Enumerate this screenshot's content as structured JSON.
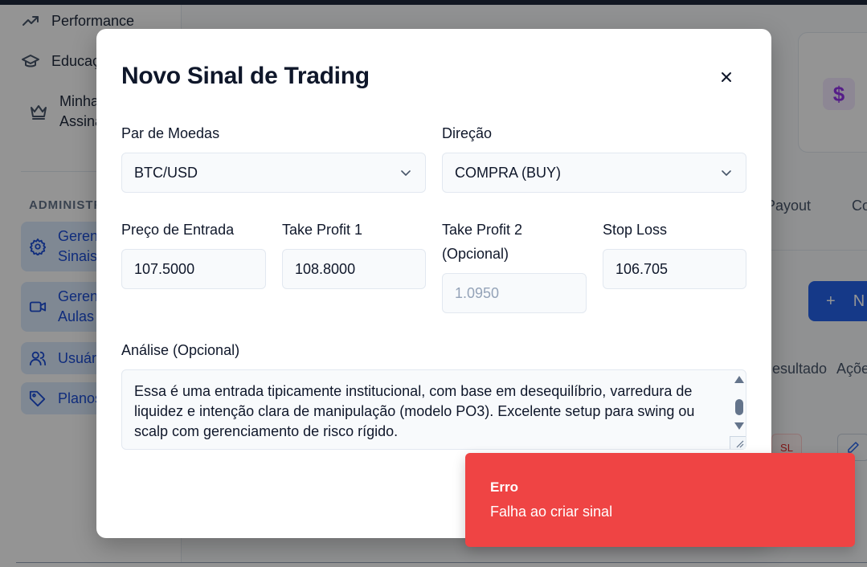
{
  "sidebar": {
    "items": [
      {
        "label": "Performance",
        "icon": "trending-up-icon"
      },
      {
        "label": "Educação",
        "icon": "graduation-cap-icon"
      },
      {
        "label_line1": "Minha",
        "label_line2": "Assinatura",
        "icon": "crown-icon"
      }
    ],
    "section_label": "ADMINISTRAÇÃO",
    "admin_items": [
      {
        "label_line1": "Gerenciar",
        "label_line2": "Sinais",
        "icon": "gear-icon"
      },
      {
        "label_line1": "Gerenciar",
        "label_line2": "Aulas",
        "icon": "video-icon"
      },
      {
        "label": "Usuários",
        "icon": "users-icon"
      },
      {
        "label": "Planos",
        "icon": "tag-icon"
      }
    ]
  },
  "background": {
    "stat_icon": "$",
    "tabs": [
      "Payout",
      "Co"
    ],
    "new_button_label": "N",
    "table_headers": [
      "Resultado",
      "Ações"
    ],
    "sl_badge": "SL"
  },
  "modal": {
    "title": "Novo Sinal de Trading",
    "fields": {
      "pair": {
        "label": "Par de Moedas",
        "value": "BTC/USD"
      },
      "direction": {
        "label": "Direção",
        "value": "COMPRA (BUY)"
      },
      "entry": {
        "label": "Preço de Entrada",
        "value": "107.5000"
      },
      "tp1": {
        "label": "Take Profit 1",
        "value": "108.8000"
      },
      "tp2": {
        "label_line1": "Take Profit 2",
        "label_line2": "(Opcional)",
        "placeholder": "1.0950"
      },
      "stop": {
        "label": "Stop Loss",
        "value": "106.705"
      },
      "analysis": {
        "label": "Análise (Opcional)",
        "value": "Essa é uma entrada tipicamente institucional, com base em desequilíbrio, varredura de liquidez e intenção clara de manipulação (modelo PO3). Excelente setup para swing ou scalp com gerenciamento de risco rígido."
      }
    }
  },
  "toast": {
    "title": "Erro",
    "message": "Falha ao criar sinal",
    "color": "#ef4444"
  }
}
